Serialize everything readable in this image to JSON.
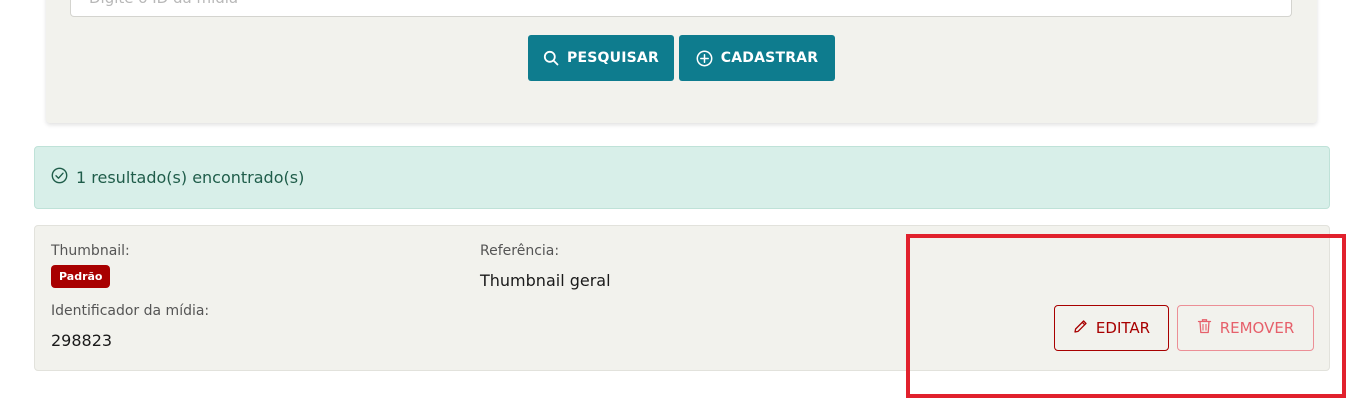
{
  "search": {
    "placeholder": "Digite o ID da mídia",
    "search_button_label": "PESQUISAR",
    "register_button_label": "CADASTRAR"
  },
  "alert": {
    "message": "1 resultado(s) encontrado(s)"
  },
  "result": {
    "thumbnail_label": "Thumbnail:",
    "thumbnail_badge": "Padrão",
    "media_id_label": "Identificador da mídia:",
    "media_id_value": "298823",
    "reference_label": "Referência:",
    "reference_value": "Thumbnail geral",
    "edit_label": "EDITAR",
    "remove_label": "REMOVER"
  },
  "colors": {
    "primary": "#0e7c8e",
    "alert_bg": "#d8efe9",
    "alert_text": "#1f5d4a",
    "badge_bg": "#a80000",
    "edit": "#a80000",
    "remove": "#e6606b",
    "highlight": "#e1212d"
  },
  "icons": {
    "search": "search-icon",
    "register": "plus-circle-icon",
    "alert": "check-circle-icon",
    "edit": "pencil-icon",
    "remove": "trash-icon"
  }
}
